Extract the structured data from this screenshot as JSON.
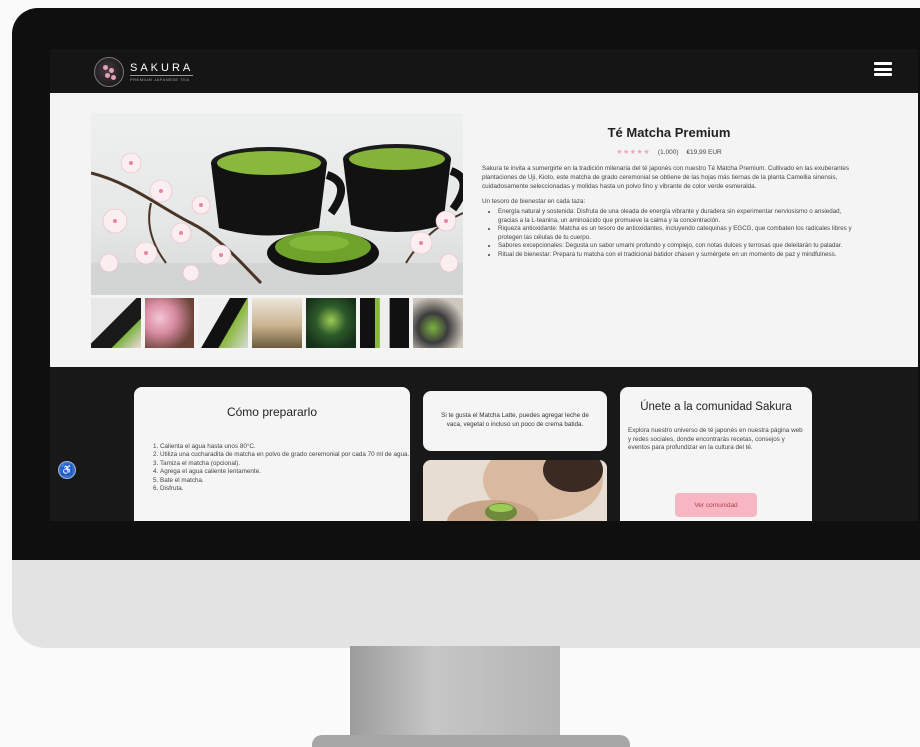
{
  "brand": {
    "name": "SAKURA",
    "tagline": "PREMIUM JAPANESE TEA"
  },
  "product": {
    "title": "Té Matcha Premium",
    "rating_count": "(1.000)",
    "price": "€19,99 EUR",
    "rating_value": 5,
    "description": "Sakura te invita a sumergirte en la tradición milenaria del té japonés con nuestro Té Matcha Premium. Cultivado en las exuberantes plantaciones de Uji, Kioto, este matcha de grado ceremonial se obtiene de las hojas más tiernas de la planta Camellia sinensis, cuidadosamente seleccionadas y molidas hasta un polvo fino y vibrante de color verde esmeralda.",
    "benefits_title": "Un tesoro de bienestar en cada taza:",
    "benefits": [
      "Energía natural y sostenida: Disfruta de una oleada de energía vibrante y duradera sin experimentar nerviosismo o ansiedad, gracias a la L-teanina, un aminoácido que promueve la calma y la concentración.",
      "Riqueza antioxidante: Matcha es un tesoro de antioxidantes, incluyendo catequinas y EGCG, que combaten los radicales libres y protegen las células de tu cuerpo.",
      "Sabores excepcionales: Degusta un sabor umami profundo y complejo, con notas dulces y terrosas que deleitarán tu paladar.",
      "Ritual de bienestar: Prepara tu matcha con el tradicional batidor chasen y sumérgete en un momento de paz y mindfulness."
    ]
  },
  "prepare": {
    "title": "Cómo prepararlo",
    "steps": [
      "Calienta el agua hasta unos 80°C.",
      "Utiliza una cucharadita de matcha en polvo de grado ceremonial por cada 70 ml de agua.",
      "Tamiza el matcha (opcional).",
      "Agrega el agua caliente lentamente.",
      "Bate el matcha.",
      "Disfruta."
    ]
  },
  "tip": {
    "text": "Si te gusta el Matcha Latte, puedes agregar leche de vaca, vegetal o incluso un poco de crema batida."
  },
  "community": {
    "title": "Únete a la comunidad Sakura",
    "text": "Explora nuestro universo de té japonés en nuestra página web y redes sociales, donde encontrarás recetas, consejos y eventos para profundizar en la cultura del té.",
    "button_label": "Ver comunidad"
  },
  "icons": {
    "menu": "hamburger-menu-icon",
    "accessibility": "accessibility-icon",
    "stars": "star-icon"
  },
  "colors": {
    "accent_pink": "#f7b6c2",
    "star_pink": "#f0a8b8",
    "matcha_green": "#7cb342",
    "nav_bg": "#151515",
    "dark_section": "#181818"
  }
}
